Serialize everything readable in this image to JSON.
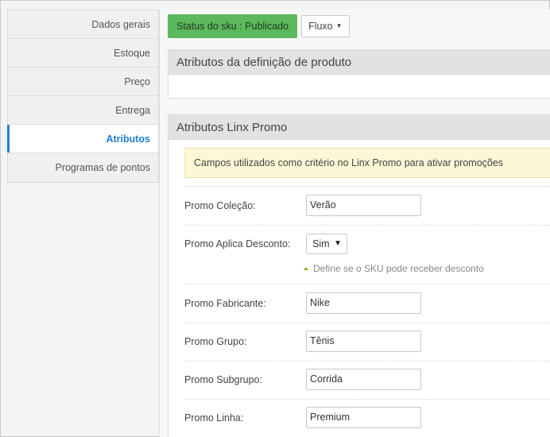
{
  "sidebar": {
    "items": [
      {
        "label": "Dados gerais"
      },
      {
        "label": "Estoque"
      },
      {
        "label": "Preço"
      },
      {
        "label": "Entrega"
      },
      {
        "label": "Atributos"
      },
      {
        "label": "Programas de pontos"
      }
    ],
    "active_index": 4
  },
  "toolbar": {
    "status_label": "Status do sku : Publicado",
    "flow_label": "Fluxo"
  },
  "panels": {
    "definition": {
      "title": "Atributos da definição de produto"
    },
    "linx_promo": {
      "title": "Atributos Linx Promo",
      "notice": "Campos utilizados como critério no Linx Promo para ativar promoções",
      "fields": {
        "colecao": {
          "label": "Promo Coleção:",
          "value": "Verão"
        },
        "aplica_desconto": {
          "label": "Promo Aplica Desconto:",
          "value": "Sim",
          "hint": "Define se o SKU pode receber desconto"
        },
        "fabricante": {
          "label": "Promo Fabricante:",
          "value": "Nike"
        },
        "grupo": {
          "label": "Promo Grupo:",
          "value": "Tênis"
        },
        "subgrupo": {
          "label": "Promo Subgrupo:",
          "value": "Corrida"
        },
        "linha": {
          "label": "Promo Linha:",
          "value": "Premium"
        }
      }
    }
  },
  "colors": {
    "accent": "#1f7fd6",
    "status_green": "#5cb85c",
    "notice_bg": "#fcf8d6",
    "hint_arrow": "#8fb21b"
  }
}
